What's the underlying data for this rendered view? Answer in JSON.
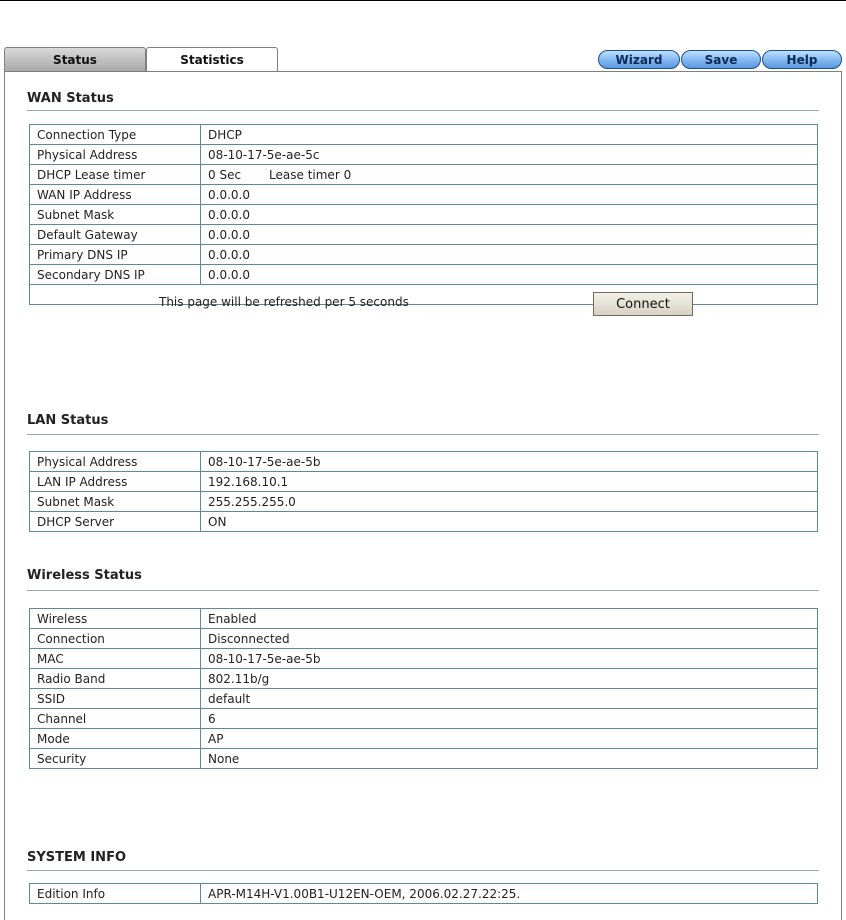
{
  "tabs": [
    {
      "label": "Status"
    },
    {
      "label": "Statistics"
    }
  ],
  "toolbar": {
    "wizard_label": "Wizard",
    "save_label": "Save",
    "help_label": "Help"
  },
  "wan": {
    "title": "WAN Status",
    "rows": [
      {
        "label": "Connection Type",
        "value": "DHCP"
      },
      {
        "label": "Physical Address",
        "value": "08-10-17-5e-ae-5c"
      },
      {
        "label": "DHCP Lease timer",
        "value": "0  Sec",
        "extra": "Lease timer 0"
      },
      {
        "label": "WAN IP Address",
        "value": "0.0.0.0"
      },
      {
        "label": "Subnet Mask",
        "value": "0.0.0.0"
      },
      {
        "label": "Default Gateway",
        "value": "0.0.0.0"
      },
      {
        "label": "Primary DNS IP",
        "value": "0.0.0.0"
      },
      {
        "label": "Secondary DNS IP",
        "value": "0.0.0.0"
      }
    ],
    "refresh_text": "This page will be refreshed per 5 seconds",
    "connect_label": "Connect"
  },
  "lan": {
    "title": "LAN Status",
    "rows": [
      {
        "label": "Physical Address",
        "value": "08-10-17-5e-ae-5b"
      },
      {
        "label": "LAN IP Address",
        "value": "192.168.10.1"
      },
      {
        "label": "Subnet Mask",
        "value": "255.255.255.0"
      },
      {
        "label": "DHCP Server",
        "value": "ON"
      }
    ]
  },
  "wireless": {
    "title": "Wireless Status",
    "rows": [
      {
        "label": "Wireless",
        "value": "Enabled"
      },
      {
        "label": "Connection",
        "value": "Disconnected"
      },
      {
        "label": "MAC",
        "value": "08-10-17-5e-ae-5b"
      },
      {
        "label": "Radio Band",
        "value": "802.11b/g"
      },
      {
        "label": "SSID",
        "value": "default"
      },
      {
        "label": "Channel",
        "value": "6"
      },
      {
        "label": "Mode",
        "value": "AP"
      },
      {
        "label": "Security",
        "value": "None"
      }
    ]
  },
  "system": {
    "title": "SYSTEM INFO",
    "rows": [
      {
        "label": "Edition Info",
        "value": "APR-M14H-V1.00B1-U12EN-OEM, 2006.02.27.22:25."
      }
    ]
  }
}
